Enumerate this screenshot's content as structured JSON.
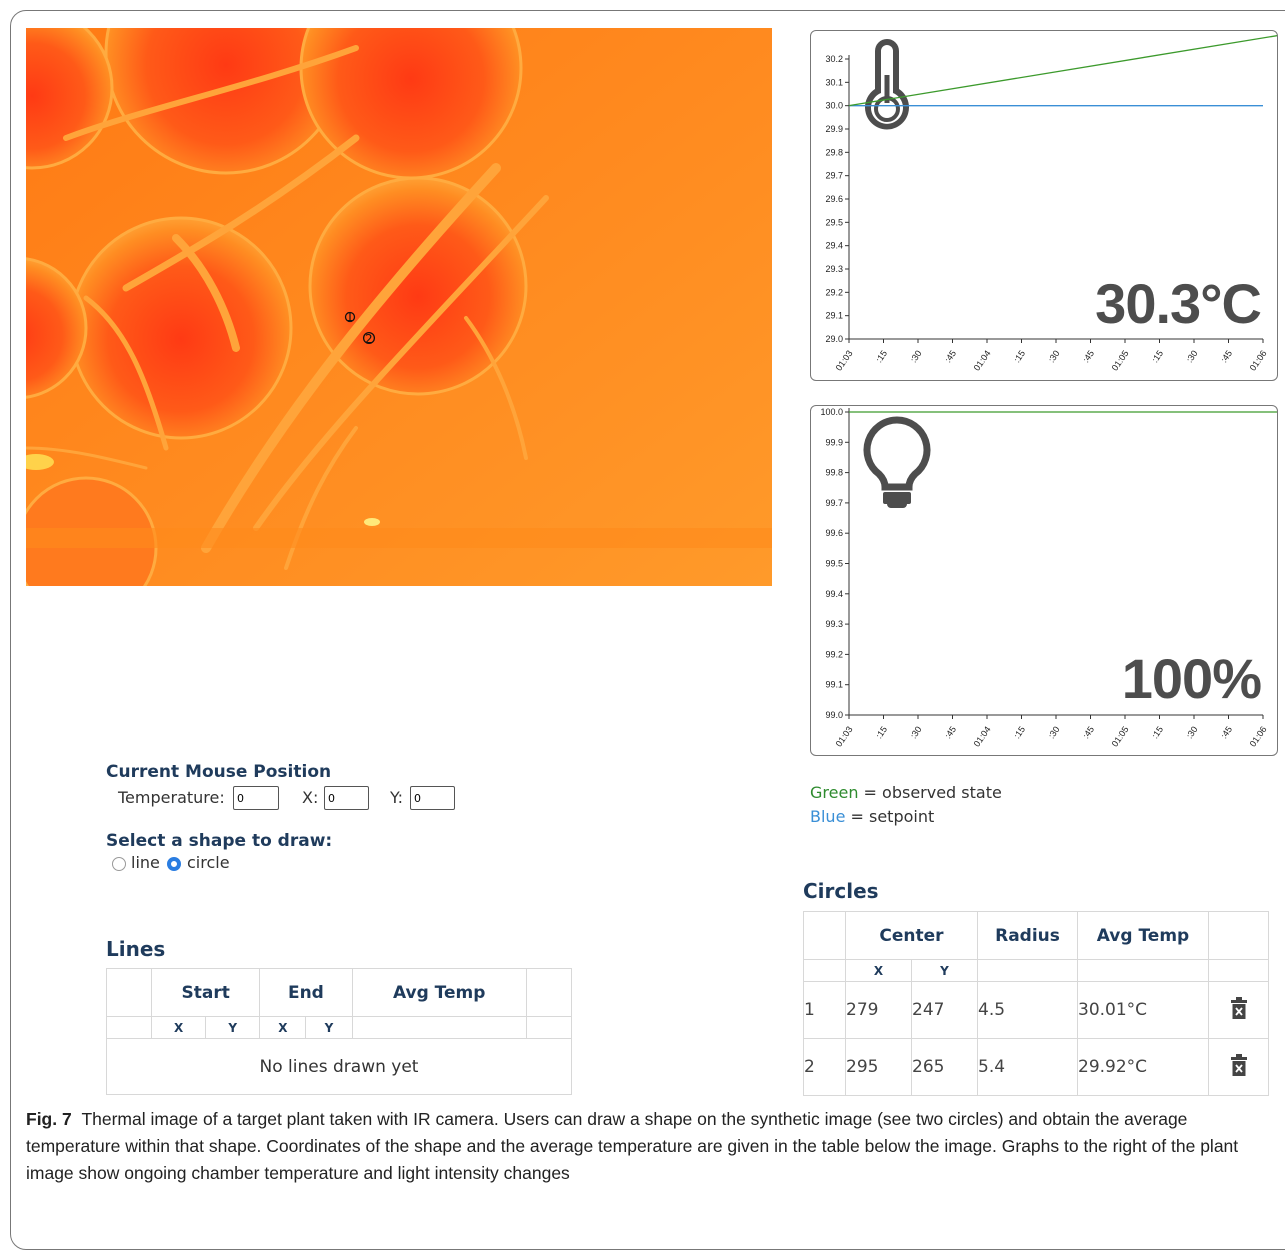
{
  "temperature_chart": {
    "y_ticks": [
      "30.2",
      "30.1",
      "30.0",
      "29.9",
      "29.8",
      "29.7",
      "29.6",
      "29.5",
      "29.4",
      "29.3",
      "29.2",
      "29.1",
      "29.0"
    ],
    "x_ticks": [
      "01:03",
      ":15",
      ":30",
      ":45",
      "01:04",
      ":15",
      ":30",
      ":45",
      "01:05",
      ":15",
      ":30",
      ":45",
      "01:06"
    ],
    "ylim": [
      29.0,
      30.2
    ],
    "observed": {
      "start": 30.0,
      "end": 30.3
    },
    "setpoint": 30.0,
    "reading": "30.3°C",
    "icon": "thermometer-icon"
  },
  "light_chart": {
    "y_ticks": [
      "100.0",
      "99.9",
      "99.8",
      "99.7",
      "99.6",
      "99.5",
      "99.4",
      "99.3",
      "99.2",
      "99.1",
      "99.0"
    ],
    "x_ticks": [
      "01:03",
      ":15",
      ":30",
      ":45",
      "01:04",
      ":15",
      ":30",
      ":45",
      "01:05",
      ":15",
      ":30",
      ":45",
      "01:06"
    ],
    "ylim": [
      99.0,
      100.0
    ],
    "observed": {
      "start": 100.0,
      "end": 100.0
    },
    "reading": "100%",
    "icon": "lightbulb-icon"
  },
  "legend": {
    "green_word": "Green",
    "green_text": " = observed state",
    "blue_word": "Blue",
    "blue_text": " = setpoint"
  },
  "mouse_position": {
    "title": "Current Mouse Position",
    "temperature_label": "Temperature:",
    "temperature_value": "0",
    "x_label": "X:",
    "x_value": "0",
    "y_label": "Y:",
    "y_value": "0"
  },
  "shape_select": {
    "title": "Select a shape to draw:",
    "options": [
      "line",
      "circle"
    ],
    "selected": "circle"
  },
  "image_markers": [
    "1",
    "2"
  ],
  "lines_table": {
    "title": "Lines",
    "headers": [
      "Start",
      "End",
      "Avg Temp"
    ],
    "subheaders": [
      "X",
      "Y",
      "X",
      "Y"
    ],
    "empty_message": "No lines drawn yet"
  },
  "circles_table": {
    "title": "Circles",
    "headers": [
      "Center",
      "Radius",
      "Avg Temp"
    ],
    "subheaders": [
      "X",
      "Y"
    ],
    "rows": [
      {
        "index": "1",
        "x": "279",
        "y": "247",
        "radius": "4.5",
        "avg_temp": "30.01°C"
      },
      {
        "index": "2",
        "x": "295",
        "y": "265",
        "radius": "5.4",
        "avg_temp": "29.92°C"
      }
    ],
    "delete_icon": "trash-icon"
  },
  "caption": {
    "label": "Fig. 7",
    "text": "Thermal image of a target plant taken with IR camera. Users can draw a shape on the synthetic image (see two circles) and obtain the average temperature within that shape. Coordinates of the shape and the average temperature are given in the table below the image. Graphs to the right of the plant image show ongoing chamber temperature and light intensity changes"
  },
  "colors": {
    "observed": "#3c9a2c",
    "setpoint": "#3a8fd6",
    "thermal_base": "#ff8a1a",
    "heading": "#1f3b5c"
  }
}
